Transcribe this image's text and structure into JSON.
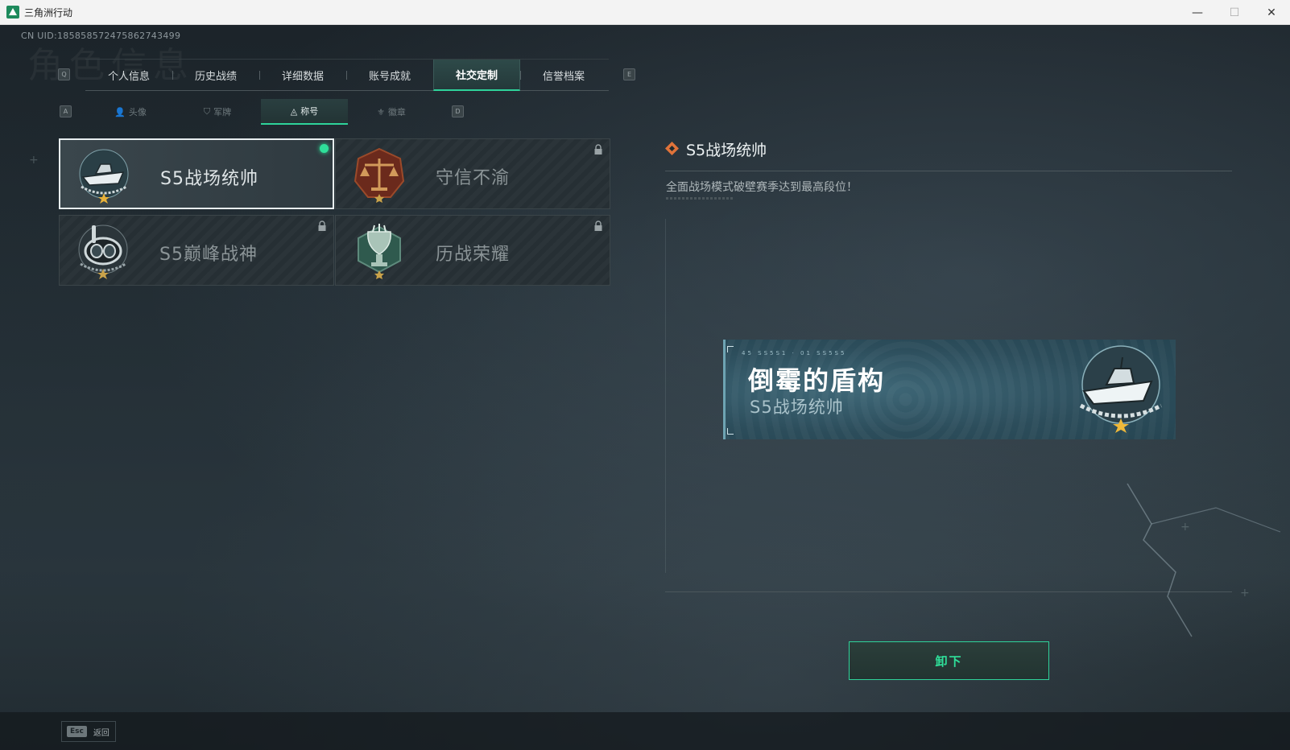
{
  "window": {
    "title": "三角洲行动",
    "min": "—",
    "max": "☐",
    "close": "✕"
  },
  "header": {
    "uid": "CN UID:1858585724758627434​99",
    "bg_title": "角色信息"
  },
  "main_tabs": {
    "prev_key": "Q",
    "next_key": "E",
    "items": [
      {
        "label": "个人信息"
      },
      {
        "label": "历史战绩"
      },
      {
        "label": "详细数据"
      },
      {
        "label": "账号成就"
      },
      {
        "label": "社交定制"
      },
      {
        "label": "信誉档案"
      }
    ]
  },
  "sub_tabs": {
    "prev_key": "A",
    "next_key": "D",
    "items": [
      {
        "label": "头像",
        "icon": "user-icon",
        "glyph": "👤"
      },
      {
        "label": "军牌",
        "icon": "dogtag-icon",
        "glyph": "⛉"
      },
      {
        "label": "称号",
        "icon": "title-icon",
        "glyph": "◬"
      },
      {
        "label": "徽章",
        "icon": "badge-icon",
        "glyph": "⚜"
      }
    ]
  },
  "titles": [
    {
      "label": "S5战场统帅",
      "emblem": "boat-emblem-icon",
      "selected": true,
      "locked": false
    },
    {
      "label": "守信不渝",
      "emblem": "scales-emblem-icon",
      "selected": false,
      "locked": true
    },
    {
      "label": "S5巅峰战神",
      "emblem": "diver-emblem-icon",
      "selected": false,
      "locked": true
    },
    {
      "label": "历战荣耀",
      "emblem": "trophy-emblem-icon",
      "selected": false,
      "locked": true
    }
  ],
  "detail": {
    "title": "S5战场统帅",
    "description": "全面战场模式破壁赛季达到最高段位！"
  },
  "namecard": {
    "code": "45 SS5S1 · 01 SS5S5",
    "player_name": "倒霉的盾构",
    "title": "S5战场统帅"
  },
  "actions": {
    "unequip": "卸下"
  },
  "footer": {
    "esc_key": "Esc",
    "esc_label": "返回"
  },
  "colors": {
    "accent": "#2fe09a",
    "active_tab": "#2e4a49",
    "namecard": "#2c4d5b"
  }
}
